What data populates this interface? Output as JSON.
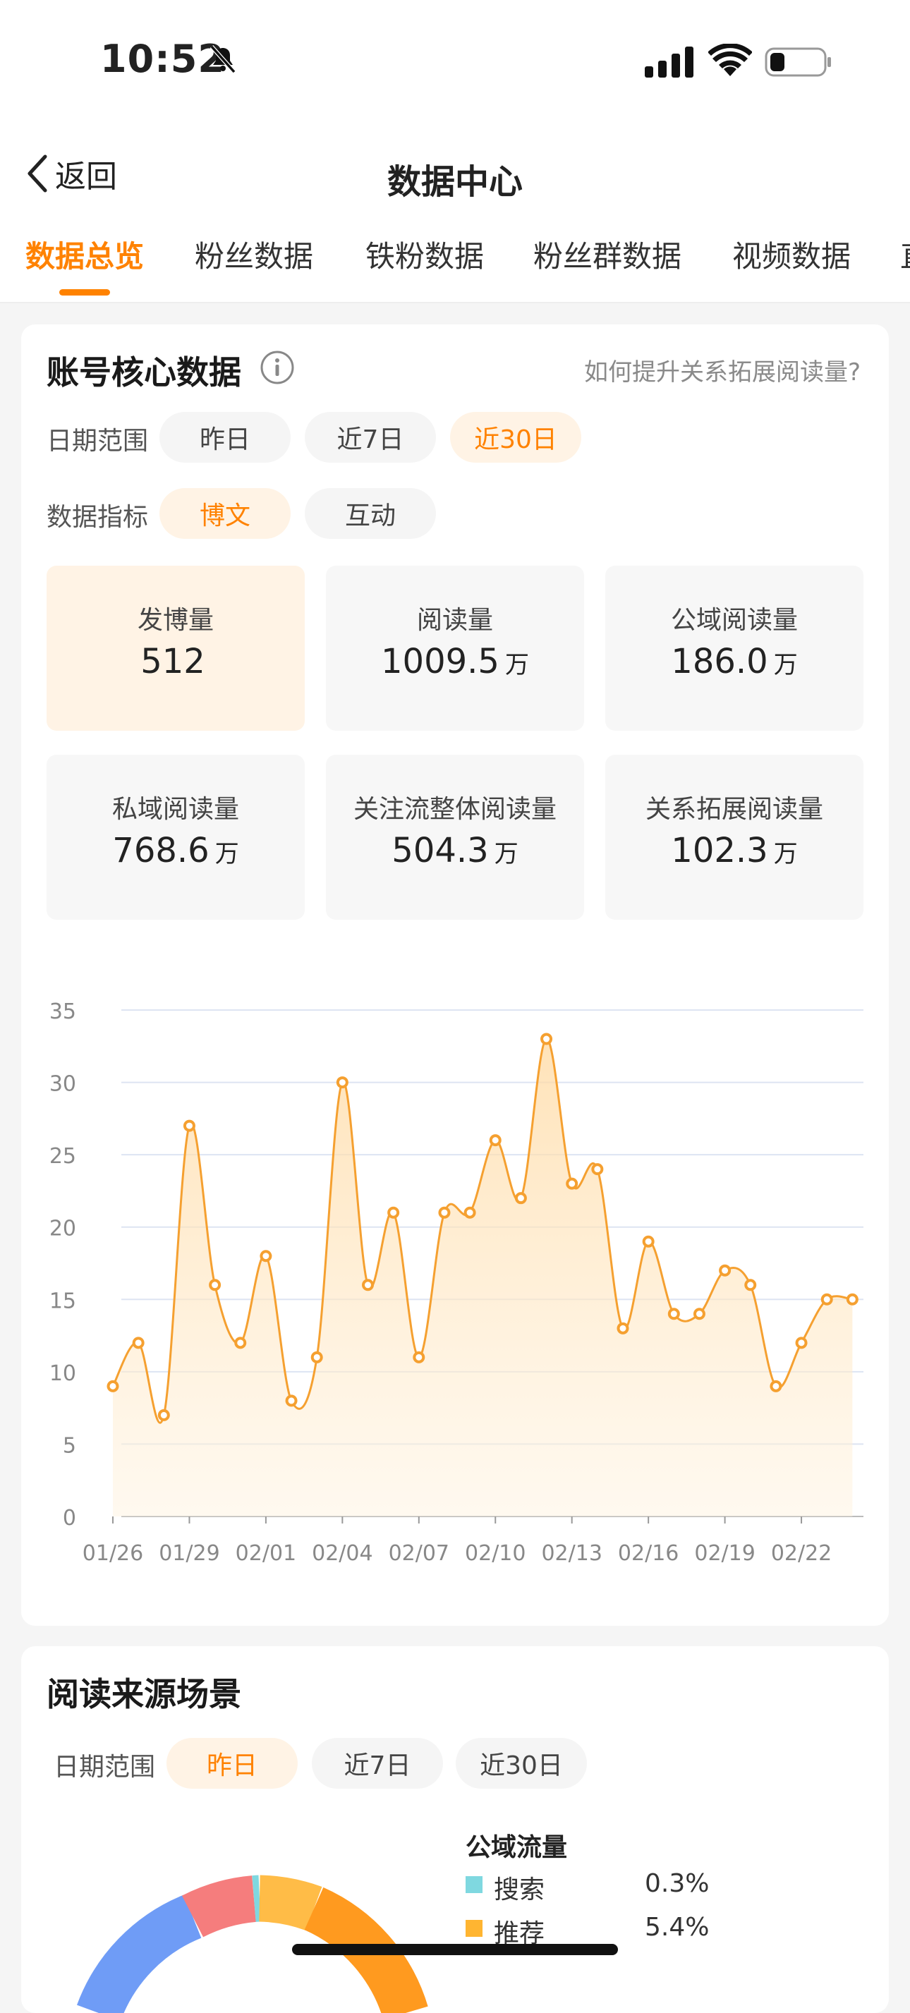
{
  "status_bar": {
    "time": "10:52"
  },
  "nav": {
    "back_label": "返回",
    "title": "数据中心"
  },
  "tabs": [
    "数据总览",
    "粉丝数据",
    "铁粉数据",
    "粉丝群数据",
    "视频数据",
    "直"
  ],
  "core": {
    "title": "账号核心数据",
    "help_link": "如何提升关系拓展阅读量?",
    "date_label": "日期范围",
    "date_options": [
      "昨日",
      "近7日",
      "近30日"
    ],
    "metric_label": "数据指标",
    "metric_options": [
      "博文",
      "互动"
    ],
    "stats": [
      {
        "label": "发博量",
        "value": "512",
        "unit": ""
      },
      {
        "label": "阅读量",
        "value": "1009.5",
        "unit": "万"
      },
      {
        "label": "公域阅读量",
        "value": "186.0",
        "unit": "万"
      },
      {
        "label": "私域阅读量",
        "value": "768.6",
        "unit": "万"
      },
      {
        "label": "关注流整体阅读量",
        "value": "504.3",
        "unit": "万"
      },
      {
        "label": "关系拓展阅读量",
        "value": "102.3",
        "unit": "万"
      }
    ]
  },
  "chart_data": {
    "type": "area",
    "x": [
      "01/26",
      "01/27",
      "01/28",
      "01/29",
      "01/30",
      "01/31",
      "02/01",
      "02/02",
      "02/03",
      "02/04",
      "02/05",
      "02/06",
      "02/07",
      "02/08",
      "02/09",
      "02/10",
      "02/11",
      "02/12",
      "02/13",
      "02/14",
      "02/15",
      "02/16",
      "02/17",
      "02/18",
      "02/19",
      "02/20",
      "02/21",
      "02/22",
      "02/23",
      "02/24"
    ],
    "x_tick_labels": [
      "01/26",
      "01/29",
      "02/01",
      "02/04",
      "02/07",
      "02/10",
      "02/13",
      "02/16",
      "02/19",
      "02/22"
    ],
    "values": [
      9,
      12,
      7,
      27,
      16,
      12,
      18,
      8,
      11,
      30,
      16,
      21,
      11,
      21,
      21,
      26,
      22,
      33,
      23,
      24,
      13,
      19,
      14,
      14,
      17,
      16,
      9,
      12,
      15,
      15
    ],
    "ylim": [
      0,
      35
    ],
    "y_ticks": [
      0,
      5,
      10,
      15,
      20,
      25,
      30,
      35
    ],
    "grid": true,
    "color": "#f5a030"
  },
  "source": {
    "title": "阅读来源场景",
    "date_label": "日期范围",
    "date_options": [
      "昨日",
      "近7日",
      "近30日"
    ],
    "legend_title": "公域流量",
    "legend": [
      {
        "name": "搜索",
        "value": "0.3%",
        "color": "#7fd8e0"
      },
      {
        "name": "推荐",
        "value": "5.4%",
        "color": "#ffb531"
      }
    ]
  },
  "colors": {
    "accent": "#ff8200",
    "pill_active_bg": "#fff3e5"
  }
}
